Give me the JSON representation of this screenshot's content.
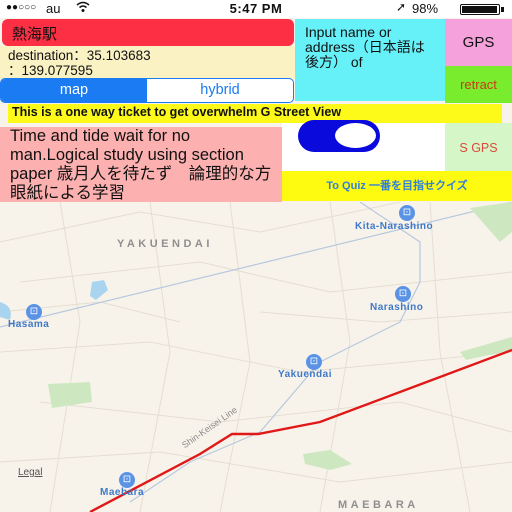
{
  "status_bar": {
    "signal": "●●○○○",
    "carrier": "au",
    "wifi_icon": "wifi-icon",
    "time": "5:47 PM",
    "location_icon": "location-arrow-icon",
    "battery_percent": "98%",
    "battery_level": 0.98
  },
  "station_name": "熱海駅",
  "destination": {
    "line1": "destination：35.103683",
    "line2": "：139.077595"
  },
  "map_type": {
    "options": [
      "map",
      "hybrid"
    ],
    "selected": "map"
  },
  "input_prompt": "Input name or address（日本語は後方） of",
  "buttons": {
    "gps": "GPS",
    "retract": "retract",
    "s_gps": "S GPS",
    "quiz": "To Quiz 一番を目指せクイズ"
  },
  "banner": "This is a one way ticket to get overwhelm G Street View",
  "quote": "Time and tide wait for no man.Logical study using section paper 歳月人を待たず　論理的な方眼紙による学習",
  "toggle": {
    "on": true
  },
  "map": {
    "areas": [
      "YAKUENDAI",
      "MAEBARA"
    ],
    "stations": [
      "Kita-Narashino",
      "Hasama",
      "Narashino",
      "Yakuendai",
      "Maebara"
    ],
    "line_label": "Shin-Keisei Line",
    "legal": "Legal",
    "route_color": "#e01818"
  }
}
